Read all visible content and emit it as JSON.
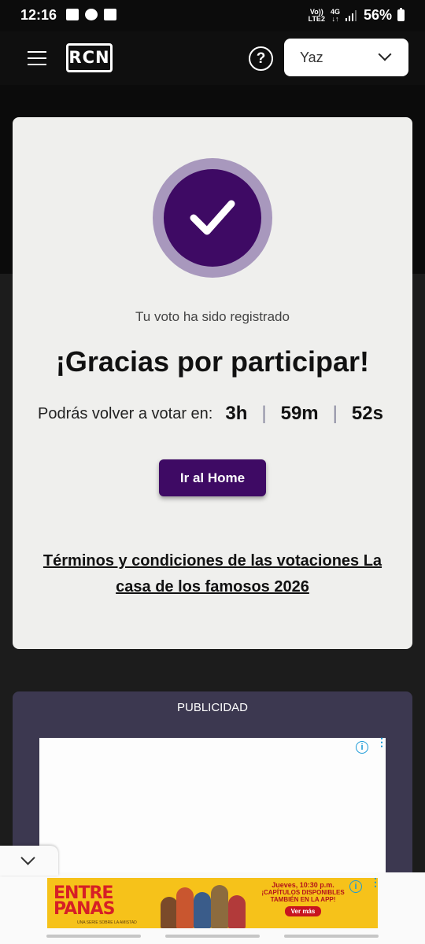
{
  "status_bar": {
    "time": "12:16",
    "network_top": "Vo))",
    "network_bottom": "LTE2",
    "network_type": "4G",
    "battery": "56%"
  },
  "header": {
    "logo_text": "RCN",
    "help_label": "?",
    "user_selector": {
      "value": "Yaz"
    }
  },
  "confirmation": {
    "subtitle": "Tu voto ha sido registrado",
    "title": "¡Gracias por participar!",
    "countdown": {
      "label": "Podrás volver a votar en:",
      "hours": "3h",
      "minutes": "59m",
      "seconds": "52s",
      "separator": "|"
    },
    "home_button": "Ir al Home",
    "terms_link": "Términos y condiciones de las votaciones La casa de los famosos 2026"
  },
  "ad_section": {
    "label": "PUBLICIDAD",
    "info_icon": "i",
    "menu_icon": "⋮"
  },
  "bottom_banner": {
    "brand": "ENTRE PANAS",
    "tagline": "UNA SERIE SOBRE LA AMISTAD",
    "schedule": "Jueves, 10:30 p.m.",
    "promo": "¡CAPÍTULOS DISPONIBLES",
    "promo2": "TAMBIÉN EN LA APP!",
    "cta": "Ver más",
    "info_icon": "i",
    "menu_icon": "⋮"
  },
  "colors": {
    "primary_purple": "#3e0a64",
    "check_ring": "#a898bd",
    "card_bg": "#efefed",
    "ad_bg": "#3c3850",
    "banner_yellow": "#f6c21a"
  }
}
